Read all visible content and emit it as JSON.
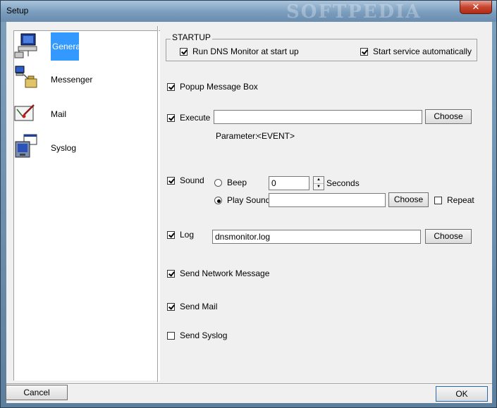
{
  "window": {
    "title": "Setup",
    "watermark": "SOFTPEDIA",
    "close_glyph": "✕"
  },
  "sidebar": {
    "items": [
      {
        "label": "General",
        "icon": "computer-network-icon",
        "selected": true
      },
      {
        "label": "Messenger",
        "icon": "messenger-icon",
        "selected": false
      },
      {
        "label": "Mail",
        "icon": "mail-icon",
        "selected": false
      },
      {
        "label": "Syslog",
        "icon": "syslog-icon",
        "selected": false
      }
    ]
  },
  "startup": {
    "title": "STARTUP",
    "run_dns_monitor": {
      "label": "Run DNS Monitor at start up",
      "checked": true
    },
    "start_service": {
      "label": "Start service automatically",
      "checked": true
    }
  },
  "popup": {
    "label": "Popup Message Box",
    "checked": true
  },
  "execute": {
    "label": "Execute",
    "checked": true,
    "value": "",
    "choose_label": "Choose",
    "parameter_label": "Parameter:",
    "parameter_value": "<EVENT>"
  },
  "sound": {
    "label": "Sound",
    "checked": true,
    "beep_label": "Beep",
    "beep_selected": false,
    "seconds_value": "0",
    "seconds_label": "Seconds",
    "play_sound_label": "Play Sound",
    "play_sound_selected": true,
    "play_sound_value": "",
    "choose_label": "Choose",
    "repeat_label": "Repeat",
    "repeat_checked": false
  },
  "log": {
    "label": "Log",
    "checked": true,
    "value": "dnsmonitor.log",
    "choose_label": "Choose"
  },
  "send_network": {
    "label": "Send Network Message",
    "checked": true
  },
  "send_mail": {
    "label": "Send Mail",
    "checked": true
  },
  "send_syslog": {
    "label": "Send Syslog",
    "checked": false
  },
  "footer": {
    "cancel_label": "Cancel",
    "ok_label": "OK"
  }
}
